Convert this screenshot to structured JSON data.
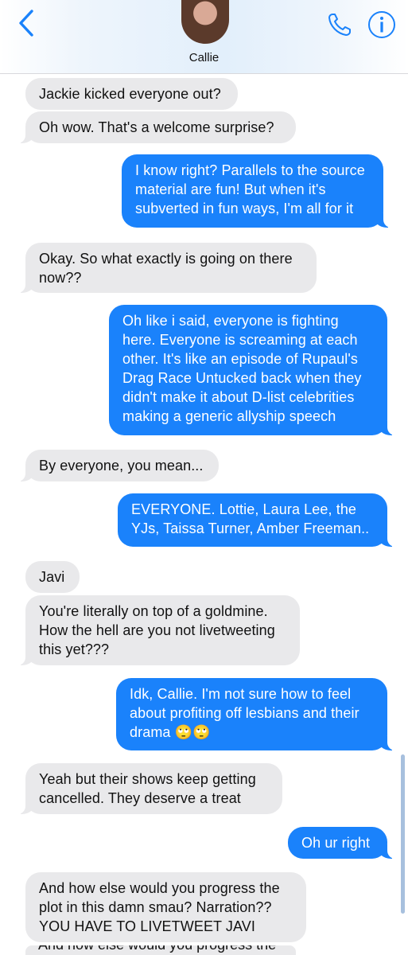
{
  "header": {
    "contact_name": "Callie",
    "accent_color": "#1a82fb",
    "icons": [
      "chevron-left-icon",
      "avatar",
      "phone-icon",
      "info-icon"
    ]
  },
  "messages": [
    {
      "side": "in",
      "text": "Jackie kicked everyone out?"
    },
    {
      "side": "in",
      "text": "Oh wow. That's a welcome surprise?"
    },
    {
      "side": "out",
      "text": "I know right? Parallels to the source\nmaterial are fun! But when it's\nsubverted in fun ways, I'm all for it"
    },
    {
      "side": "in",
      "text": "Okay. So what exactly is going on there\nnow??"
    },
    {
      "side": "out",
      "text": "Oh like i said, everyone is fighting\nhere. Everyone is screaming at each\nother. It's like an episode of Rupaul's\nDrag Race Untucked back when they\ndidn't make it about D-list celebrities\nmaking a generic allyship speech"
    },
    {
      "side": "in",
      "text": "By everyone, you mean..."
    },
    {
      "side": "out",
      "text": "EVERYONE. Lottie, Laura Lee, the\nYJs, Taissa Turner, Amber Freeman.."
    },
    {
      "side": "in",
      "text": "Javi"
    },
    {
      "side": "in",
      "text": "You're literally on top of a goldmine.\nHow the hell are you not livetweeting\nthis yet???"
    },
    {
      "side": "out",
      "text": "Idk, Callie. I'm not sure how to feel\nabout profiting off lesbians and their\ndrama 🙄🙄"
    },
    {
      "side": "in",
      "text": "Yeah but their shows keep getting\ncancelled. They deserve a treat"
    },
    {
      "side": "out",
      "text": "Oh ur right"
    },
    {
      "side": "in",
      "text": "And how else would you progress the\nplot in this damn smau? Narration??\nYOU HAVE TO LIVETWEET JAVI"
    }
  ],
  "cut_off_message": "And how else would you progress the"
}
